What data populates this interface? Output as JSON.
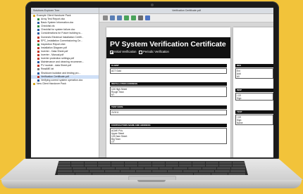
{
  "tree_pane": {
    "header": "Solutions Explorer Tree",
    "items": [
      {
        "label": "Example Client Handover Pack",
        "indent": 0,
        "icon": "folder-icon",
        "color": "#d6a928"
      },
      {
        "label": "Array Test Report.xlsx",
        "indent": 2,
        "icon": "file-icon",
        "color": "#2e8b3e"
      },
      {
        "label": "Basic System Information.doc",
        "indent": 2,
        "icon": "file-icon",
        "color": "#2c5aa0"
      },
      {
        "label": "Checklist.xls",
        "indent": 2,
        "icon": "file-icon",
        "color": "#2e8b3e"
      },
      {
        "label": "Checklist for system failure.doc",
        "indent": 2,
        "icon": "file-icon",
        "color": "#2c5aa0"
      },
      {
        "label": "Considerations for Future building w...",
        "indent": 2,
        "icon": "file-icon",
        "color": "#2c5aa0"
      },
      {
        "label": "Domestic Electrical Installation Certifi...",
        "indent": 2,
        "icon": "file-icon",
        "color": "#c0392b"
      },
      {
        "label": "EPC_Installation Commissioning Ce...",
        "indent": 2,
        "icon": "file-icon",
        "color": "#c0392b"
      },
      {
        "label": "Inspection Report.xlsb",
        "indent": 2,
        "icon": "file-icon",
        "color": "#2e8b3e"
      },
      {
        "label": "Installation Diagram.pdf",
        "indent": 2,
        "icon": "file-icon",
        "color": "#c0392b"
      },
      {
        "label": "Inverter - Data Sheet.pdf",
        "indent": 2,
        "icon": "file-icon",
        "color": "#c0392b"
      },
      {
        "label": "Inverter - Manual.pdf",
        "indent": 2,
        "icon": "file-icon",
        "color": "#c0392b"
      },
      {
        "label": "Inverter protection settings.pdf",
        "indent": 2,
        "icon": "file-icon",
        "color": "#c0392b"
      },
      {
        "label": "Maintenance and cleaning recommen...",
        "indent": 2,
        "icon": "file-icon",
        "color": "#2c5aa0"
      },
      {
        "label": "PV module - data Sheet.pdf",
        "indent": 2,
        "icon": "file-icon",
        "color": "#c0392b"
      },
      {
        "label": "ReadME.txt",
        "indent": 2,
        "icon": "file-icon",
        "color": "#777777"
      },
      {
        "label": "Shutdown isolation and testing pro...",
        "indent": 2,
        "icon": "file-icon",
        "color": "#2c5aa0"
      },
      {
        "label": "Verification Certificate.pdf",
        "indent": 2,
        "icon": "file-icon",
        "color": "#c0392b",
        "selected": true
      },
      {
        "label": "Verifying correct system operation.doc",
        "indent": 2,
        "icon": "file-icon",
        "color": "#2c5aa0"
      },
      {
        "label": "New Client Handover Pack",
        "indent": 0,
        "icon": "folder-icon",
        "color": "#d6a928"
      }
    ]
  },
  "viewer": {
    "window_title": "Verification Certificate.pdf"
  },
  "toolbar": {
    "buttons": [
      {
        "name": "hand-tool-icon",
        "color": "#8a8a8a"
      },
      {
        "name": "zoom-in-icon",
        "color": "#5a7fb5"
      },
      {
        "name": "zoom-out-icon",
        "color": "#5a7fb5"
      },
      {
        "name": "fit-page-icon",
        "color": "#4aa35a"
      },
      {
        "name": "fit-width-icon",
        "color": "#4aa35a"
      },
      {
        "name": "print-icon",
        "color": "#6b6b6b"
      },
      {
        "name": "save-icon",
        "color": "#4d74c4"
      }
    ]
  },
  "certificate": {
    "title": "PV System Verification Certificate",
    "initial_label": "Initial Verification",
    "initial_checked": true,
    "periodic_label": "Periodic Verification",
    "periodic_checked": false,
    "sections": [
      {
        "label": "CLIENT",
        "lines": [
          "ACT Gold"
        ]
      },
      {
        "label": "INSTALLATION ADDRESS",
        "lines": [
          "124 High Street",
          "Rough Town",
          "NT"
        ]
      },
      {
        "label": "TEST DATE",
        "lines": [
          "21/3/11"
        ]
      },
      {
        "label": "CONTRACTORS NAME AND ADDRESS",
        "lines": [
          "ACME PVs",
          "Upper Street",
          "123 Dam Street",
          "Big Town",
          "OT"
        ]
      }
    ]
  },
  "page2": {
    "sections": [
      {
        "label": "DES",
        "lines": [
          "Ext",
          "Add",
          "All"
        ]
      },
      {
        "label": "INSP",
        "lines": [
          "I CE",
          "Sign"
        ]
      },
      {
        "label": "TEST",
        "lines": [
          "I CE",
          "Sign",
          "Name"
        ]
      }
    ]
  }
}
